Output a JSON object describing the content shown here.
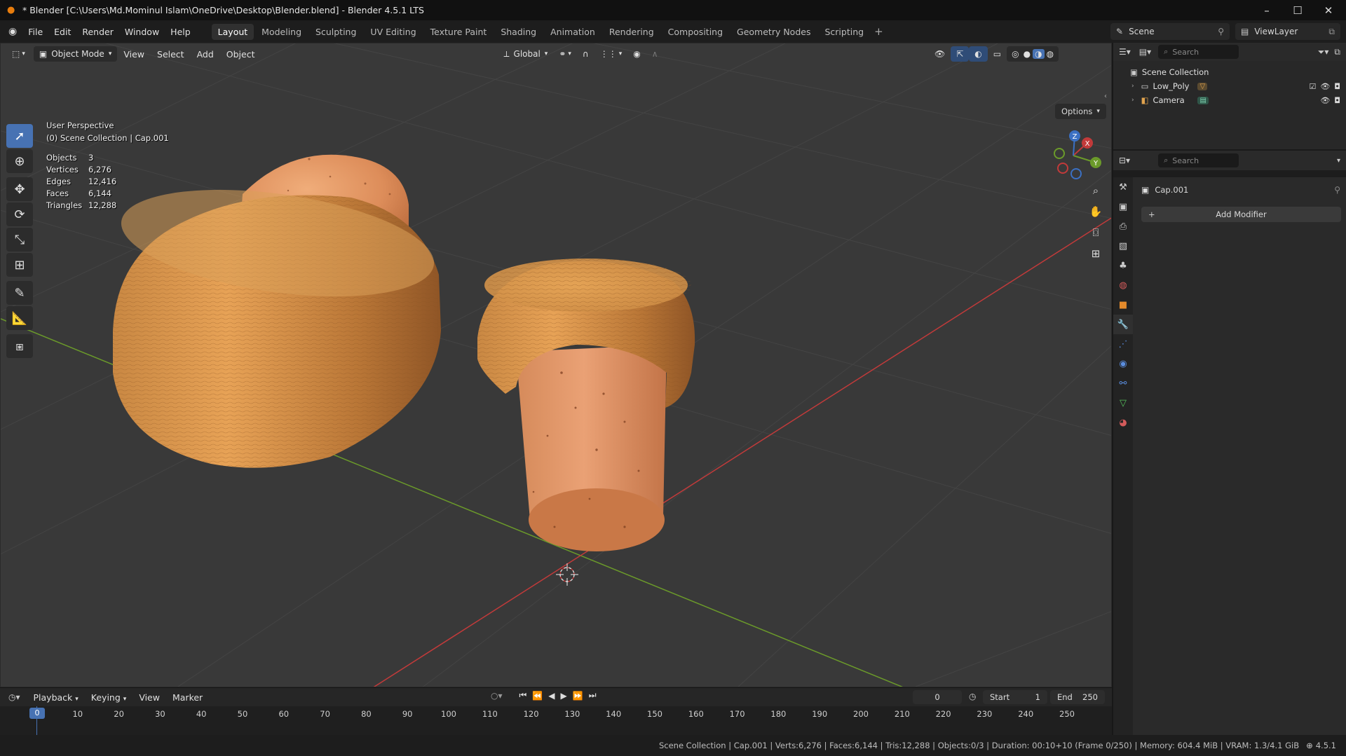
{
  "window": {
    "title": "* Blender [C:\\Users\\Md.Mominul Islam\\OneDrive\\Desktop\\Blender.blend] - Blender 4.5.1 LTS",
    "controls": [
      "–",
      "☐",
      "✕"
    ]
  },
  "menus": [
    "File",
    "Edit",
    "Render",
    "Window",
    "Help"
  ],
  "workspaces": [
    {
      "label": "Layout",
      "active": true
    },
    {
      "label": "Modeling",
      "active": false
    },
    {
      "label": "Sculpting",
      "active": false
    },
    {
      "label": "UV Editing",
      "active": false
    },
    {
      "label": "Texture Paint",
      "active": false
    },
    {
      "label": "Shading",
      "active": false
    },
    {
      "label": "Animation",
      "active": false
    },
    {
      "label": "Rendering",
      "active": false
    },
    {
      "label": "Compositing",
      "active": false
    },
    {
      "label": "Geometry Nodes",
      "active": false
    },
    {
      "label": "Scripting",
      "active": false
    }
  ],
  "scene_selector": "Scene",
  "viewlayer_selector": "ViewLayer",
  "viewport": {
    "mode": "Object Mode",
    "menus": [
      "View",
      "Select",
      "Add",
      "Object"
    ],
    "orientation": "Global",
    "options_label": "Options",
    "perspective": "User Perspective",
    "context": "(0) Scene Collection | Cap.001",
    "stats": [
      {
        "label": "Objects",
        "value": "3"
      },
      {
        "label": "Vertices",
        "value": "6,276"
      },
      {
        "label": "Edges",
        "value": "12,416"
      },
      {
        "label": "Faces",
        "value": "6,144"
      },
      {
        "label": "Triangles",
        "value": "12,288"
      }
    ],
    "gizmo": {
      "x": "X",
      "y": "Y",
      "z": "Z"
    },
    "colors": {
      "background": "#393939",
      "x_axis": "#c23a3a",
      "y_axis": "#6b9a2a",
      "cork": "#e0915a",
      "wood": "#d59444"
    }
  },
  "outliner": {
    "search_placeholder": "Search",
    "root": "Scene Collection",
    "items": [
      {
        "label": "Low_Poly",
        "icon": "collection-icon"
      },
      {
        "label": "Camera",
        "icon": "camera-icon"
      }
    ]
  },
  "properties": {
    "search_placeholder": "Search",
    "object_name": "Cap.001",
    "add_modifier": "Add Modifier"
  },
  "timeline": {
    "menus": [
      "Playback",
      "Keying",
      "View",
      "Marker"
    ],
    "current_frame": "0",
    "start_label": "Start",
    "start": "1",
    "end_label": "End",
    "end": "250",
    "ticks": [
      "0",
      "10",
      "20",
      "30",
      "40",
      "50",
      "60",
      "70",
      "80",
      "90",
      "100",
      "110",
      "120",
      "130",
      "140",
      "150",
      "160",
      "170",
      "180",
      "190",
      "200",
      "210",
      "220",
      "230",
      "240",
      "250"
    ]
  },
  "status": {
    "text": "Scene Collection | Cap.001 | Verts:6,276 | Faces:6,144 | Tris:12,288 | Objects:0/3 | Duration: 00:10+10 (Frame 0/250) | Memory: 604.4 MiB | VRAM: 1.3/4.1 GiB",
    "version": "4.5.1"
  }
}
